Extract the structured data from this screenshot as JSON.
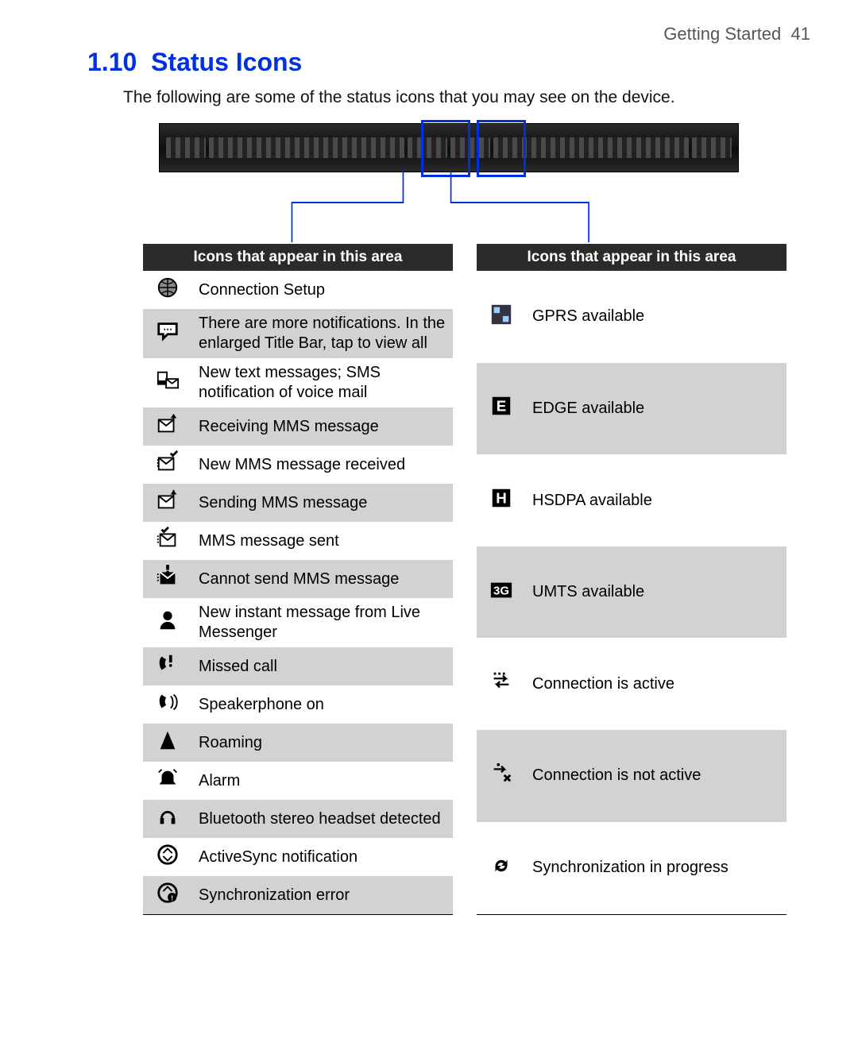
{
  "header": {
    "section": "Getting Started",
    "page": "41"
  },
  "title": {
    "number": "1.10",
    "text": "Status Icons"
  },
  "intro": "The following are some of the status icons that you may see on the device.",
  "tableLeft": {
    "header": "Icons that appear in this area",
    "rows": [
      {
        "icon": "globe-icon",
        "label": "Connection Setup"
      },
      {
        "icon": "speech-bubble-icon",
        "label": "There are more notifications. In the enlarged Title Bar, tap to view all"
      },
      {
        "icon": "sms-envelope-icon",
        "label": "New text messages; SMS notification of voice mail"
      },
      {
        "icon": "mms-receive-icon",
        "label": "Receiving MMS message"
      },
      {
        "icon": "mms-new-icon",
        "label": "New MMS message received"
      },
      {
        "icon": "mms-send-icon",
        "label": "Sending MMS message"
      },
      {
        "icon": "mms-sent-icon",
        "label": "MMS message sent"
      },
      {
        "icon": "mms-fail-icon",
        "label": "Cannot send MMS message"
      },
      {
        "icon": "im-person-icon",
        "label": "New instant message from Live Messenger"
      },
      {
        "icon": "missed-call-icon",
        "label": "Missed call"
      },
      {
        "icon": "speakerphone-icon",
        "label": "Speakerphone on"
      },
      {
        "icon": "roaming-icon",
        "label": "Roaming"
      },
      {
        "icon": "alarm-icon",
        "label": "Alarm"
      },
      {
        "icon": "bluetooth-headset-icon",
        "label": "Bluetooth stereo headset detected"
      },
      {
        "icon": "activesync-icon",
        "label": "ActiveSync notification"
      },
      {
        "icon": "sync-error-icon",
        "label": "Synchronization error"
      }
    ]
  },
  "tableRight": {
    "header": "Icons that appear in this area",
    "rows": [
      {
        "icon": "gprs-icon",
        "label": "GPRS available"
      },
      {
        "icon": "edge-icon",
        "label": "EDGE available"
      },
      {
        "icon": "hsdpa-icon",
        "label": "HSDPA available"
      },
      {
        "icon": "umts-3g-icon",
        "label": "UMTS available"
      },
      {
        "icon": "connection-active-icon",
        "label": "Connection is active"
      },
      {
        "icon": "connection-inactive-icon",
        "label": "Connection is not active"
      },
      {
        "icon": "sync-progress-icon",
        "label": "Synchronization in progress"
      }
    ]
  }
}
